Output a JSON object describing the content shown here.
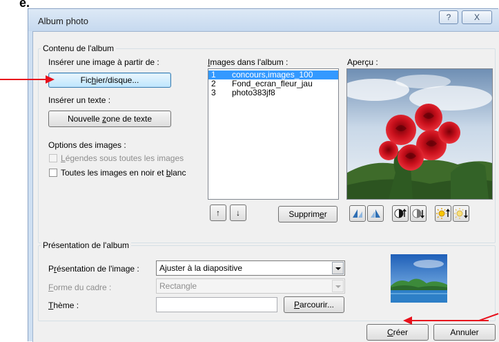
{
  "page_fragment": "e.",
  "window": {
    "title": "Album photo",
    "help_glyph": "?",
    "close_glyph": "X"
  },
  "content_group": {
    "legend": "Contenu de l'album",
    "insert_image_label": "Insérer une image à partir de :",
    "file_button": {
      "pre": "Fic",
      "acc": "h",
      "post": "ier/disque..."
    },
    "insert_text_label": "Insérer un texte :",
    "new_textbox_button": {
      "pre": "Nouvelle ",
      "acc": "z",
      "post": "one de texte"
    },
    "image_options_label": "Options des images :",
    "captions_checkbox": {
      "pre": "",
      "acc": "L",
      "post": "égendes sous toutes les images",
      "checked": false,
      "enabled": false
    },
    "bw_checkbox": {
      "pre": "Toutes les images en noir et ",
      "acc": "b",
      "post": "lanc",
      "checked": false,
      "enabled": true
    },
    "images_label": {
      "pre": "",
      "acc": "I",
      "post": "mages dans l'album :"
    },
    "images": [
      {
        "num": "1",
        "name": "concours,images_100",
        "selected": true
      },
      {
        "num": "2",
        "name": "Fond_ecran_fleur_jau",
        "selected": false
      },
      {
        "num": "3",
        "name": "photo383jf8",
        "selected": false
      }
    ],
    "move_up_glyph": "↑",
    "move_down_glyph": "↓",
    "delete_button": {
      "pre": "Supprim",
      "acc": "e",
      "post": "r"
    },
    "preview_label": "Aperçu :",
    "preview_image": "red-roses-photo"
  },
  "layout_group": {
    "legend": "Présentation de l'album",
    "picture_layout_label": {
      "pre": "P",
      "acc": "r",
      "post": "ésentation de l'image :"
    },
    "picture_layout_value": "Ajuster à la diapositive",
    "frame_shape_label": {
      "pre": "",
      "acc": "F",
      "post": "orme du cadre :"
    },
    "frame_shape_value": "Rectangle",
    "theme_label": {
      "pre": "",
      "acc": "T",
      "post": "hème :"
    },
    "theme_value": "",
    "browse_button": {
      "pre": "",
      "acc": "P",
      "post": "arcourir..."
    },
    "layout_preview_image": "landscape-thumbnail"
  },
  "footer": {
    "create_button": {
      "pre": "",
      "acc": "C",
      "post": "réer"
    },
    "cancel_button": "Annuler"
  },
  "colors": {
    "annotation_arrow": "#e8101c",
    "selection": "#3399ff",
    "dialog_bg": "#f0f0f0"
  }
}
